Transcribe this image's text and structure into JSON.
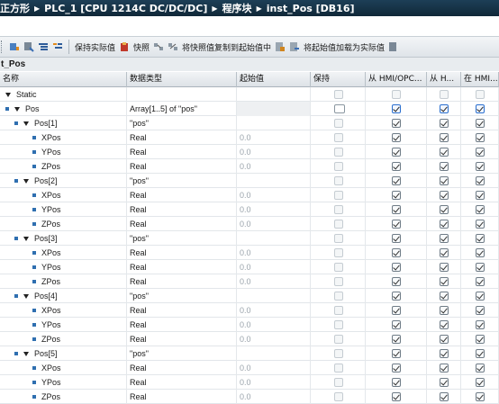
{
  "breadcrumb": [
    "正方形",
    "PLC_1 [CPU 1214C DC/DC/DC]",
    "程序块",
    "inst_Pos [DB16]"
  ],
  "toolbar": {
    "keep_actual": "保持实际值",
    "snapshot": "快照",
    "copy_snapshot_to_start": "将快照值复制到起始值中",
    "load_start_as_actual": "将起始值加载为实际值"
  },
  "block_label": "t_Pos",
  "columns": {
    "name": "名称",
    "type": "数据类型",
    "start": "起始值",
    "retain": "保持",
    "hmi_opc": "从 HMI/OPC...",
    "from_h": "从 H...",
    "in_h": "在 HMI..."
  },
  "rows": [
    {
      "name": "Static",
      "type": "",
      "start": "",
      "level": 0,
      "bullet": false,
      "tri": true,
      "retain": "dim",
      "hmi": "dim",
      "from": "dim",
      "in": "dim",
      "grey": false
    },
    {
      "name": "Pos",
      "type": "Array[1..5] of \"pos\"",
      "start": "",
      "level": 1,
      "bullet": true,
      "tri": true,
      "retain": "box",
      "hmi": "blue",
      "from": "blue",
      "in": "blue",
      "grey": true
    },
    {
      "name": "Pos[1]",
      "type": "\"pos\"",
      "start": "",
      "level": 2,
      "bullet": true,
      "tri": true,
      "retain": "dim",
      "hmi": "check",
      "from": "check",
      "in": "check",
      "grey": false
    },
    {
      "name": "XPos",
      "type": "Real",
      "start": "0.0",
      "level": 3,
      "bullet": true,
      "tri": false,
      "retain": "dim",
      "hmi": "check",
      "from": "check",
      "in": "check",
      "grey": false
    },
    {
      "name": "YPos",
      "type": "Real",
      "start": "0.0",
      "level": 3,
      "bullet": true,
      "tri": false,
      "retain": "dim",
      "hmi": "check",
      "from": "check",
      "in": "check",
      "grey": false
    },
    {
      "name": "ZPos",
      "type": "Real",
      "start": "0.0",
      "level": 3,
      "bullet": true,
      "tri": false,
      "retain": "dim",
      "hmi": "check",
      "from": "check",
      "in": "check",
      "grey": false
    },
    {
      "name": "Pos[2]",
      "type": "\"pos\"",
      "start": "",
      "level": 2,
      "bullet": true,
      "tri": true,
      "retain": "dim",
      "hmi": "check",
      "from": "check",
      "in": "check",
      "grey": false
    },
    {
      "name": "XPos",
      "type": "Real",
      "start": "0.0",
      "level": 3,
      "bullet": true,
      "tri": false,
      "retain": "dim",
      "hmi": "check",
      "from": "check",
      "in": "check",
      "grey": false
    },
    {
      "name": "YPos",
      "type": "Real",
      "start": "0.0",
      "level": 3,
      "bullet": true,
      "tri": false,
      "retain": "dim",
      "hmi": "check",
      "from": "check",
      "in": "check",
      "grey": false
    },
    {
      "name": "ZPos",
      "type": "Real",
      "start": "0.0",
      "level": 3,
      "bullet": true,
      "tri": false,
      "retain": "dim",
      "hmi": "check",
      "from": "check",
      "in": "check",
      "grey": false
    },
    {
      "name": "Pos[3]",
      "type": "\"pos\"",
      "start": "",
      "level": 2,
      "bullet": true,
      "tri": true,
      "retain": "dim",
      "hmi": "check",
      "from": "check",
      "in": "check",
      "grey": false
    },
    {
      "name": "XPos",
      "type": "Real",
      "start": "0.0",
      "level": 3,
      "bullet": true,
      "tri": false,
      "retain": "dim",
      "hmi": "check",
      "from": "check",
      "in": "check",
      "grey": false
    },
    {
      "name": "YPos",
      "type": "Real",
      "start": "0.0",
      "level": 3,
      "bullet": true,
      "tri": false,
      "retain": "dim",
      "hmi": "check",
      "from": "check",
      "in": "check",
      "grey": false
    },
    {
      "name": "ZPos",
      "type": "Real",
      "start": "0.0",
      "level": 3,
      "bullet": true,
      "tri": false,
      "retain": "dim",
      "hmi": "check",
      "from": "check",
      "in": "check",
      "grey": false
    },
    {
      "name": "Pos[4]",
      "type": "\"pos\"",
      "start": "",
      "level": 2,
      "bullet": true,
      "tri": true,
      "retain": "dim",
      "hmi": "check",
      "from": "check",
      "in": "check",
      "grey": false
    },
    {
      "name": "XPos",
      "type": "Real",
      "start": "0.0",
      "level": 3,
      "bullet": true,
      "tri": false,
      "retain": "dim",
      "hmi": "check",
      "from": "check",
      "in": "check",
      "grey": false
    },
    {
      "name": "YPos",
      "type": "Real",
      "start": "0.0",
      "level": 3,
      "bullet": true,
      "tri": false,
      "retain": "dim",
      "hmi": "check",
      "from": "check",
      "in": "check",
      "grey": false
    },
    {
      "name": "ZPos",
      "type": "Real",
      "start": "0.0",
      "level": 3,
      "bullet": true,
      "tri": false,
      "retain": "dim",
      "hmi": "check",
      "from": "check",
      "in": "check",
      "grey": false
    },
    {
      "name": "Pos[5]",
      "type": "\"pos\"",
      "start": "",
      "level": 2,
      "bullet": true,
      "tri": true,
      "retain": "dim",
      "hmi": "check",
      "from": "check",
      "in": "check",
      "grey": false
    },
    {
      "name": "XPos",
      "type": "Real",
      "start": "0.0",
      "level": 3,
      "bullet": true,
      "tri": false,
      "retain": "dim",
      "hmi": "check",
      "from": "check",
      "in": "check",
      "grey": false
    },
    {
      "name": "YPos",
      "type": "Real",
      "start": "0.0",
      "level": 3,
      "bullet": true,
      "tri": false,
      "retain": "dim",
      "hmi": "check",
      "from": "check",
      "in": "check",
      "grey": false
    },
    {
      "name": "ZPos",
      "type": "Real",
      "start": "0.0",
      "level": 3,
      "bullet": true,
      "tri": false,
      "retain": "dim",
      "hmi": "check",
      "from": "check",
      "in": "check",
      "grey": false
    }
  ]
}
